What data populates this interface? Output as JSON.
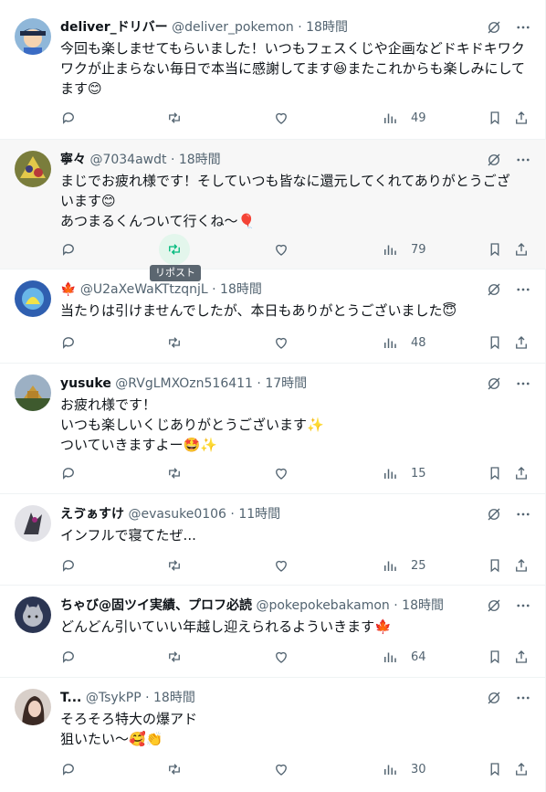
{
  "tooltip": "リポスト",
  "tweets": [
    {
      "name": "deliver_ドリバー",
      "handle": "@deliver_pokemon",
      "time": "18時間",
      "lines": [
        "今回も楽しませてもらいました！いつもフェスくじや企画などドキドキワク",
        "ワクが止まらない毎日で本当に感謝してます😆またこれからも楽しみにして",
        "ます😊"
      ],
      "views": "49",
      "avatar_color": "#3c4b66"
    },
    {
      "name": "寧々",
      "handle": "@7034awdt",
      "time": "18時間",
      "lines": [
        "まじでお疲れ様です！そしていつも皆なに還元してくれてありがとうござ",
        "います😊",
        "あつまるくんついて行くね〜🎈"
      ],
      "views": "79",
      "avatar_color": "#6b6a3a"
    },
    {
      "name": "🍁",
      "handle": "@U2aXeWaKTtzqnjL",
      "time": "18時間",
      "lines": [
        "当たりは引けませんでしたが、本日もありがとうございました😇"
      ],
      "views": "48",
      "avatar_color": "#3f6fb8"
    },
    {
      "name": "yusuke",
      "handle": "@RVgLMXOzn516411",
      "time": "17時間",
      "lines": [
        "お疲れ様です！",
        "いつも楽しいくじありがとうございます✨",
        "ついていきますよー🤩✨"
      ],
      "views": "15",
      "avatar_color": "#4a5c3a"
    },
    {
      "name": "えゔぁすけ",
      "handle": "@evasuke0106",
      "time": "11時間",
      "lines": [
        "インフルで寝てたぜ..."
      ],
      "views": "25",
      "avatar_color": "#d9d9df"
    },
    {
      "name": "ちゃび@固ツイ実績、プロフ必読",
      "handle": "@pokepokebakamon",
      "time": "18時間",
      "lines": [
        "どんどん引いていい年越し迎えられるよういきます🍁"
      ],
      "views": "64",
      "avatar_color": "#2e3a55"
    },
    {
      "name": "T...",
      "handle": "@TsykPP",
      "time": "18時間",
      "lines": [
        "そろそろ特大の爆アド",
        "狙いたい〜🥰👏"
      ],
      "views": "30",
      "avatar_color": "#8a7470"
    }
  ]
}
